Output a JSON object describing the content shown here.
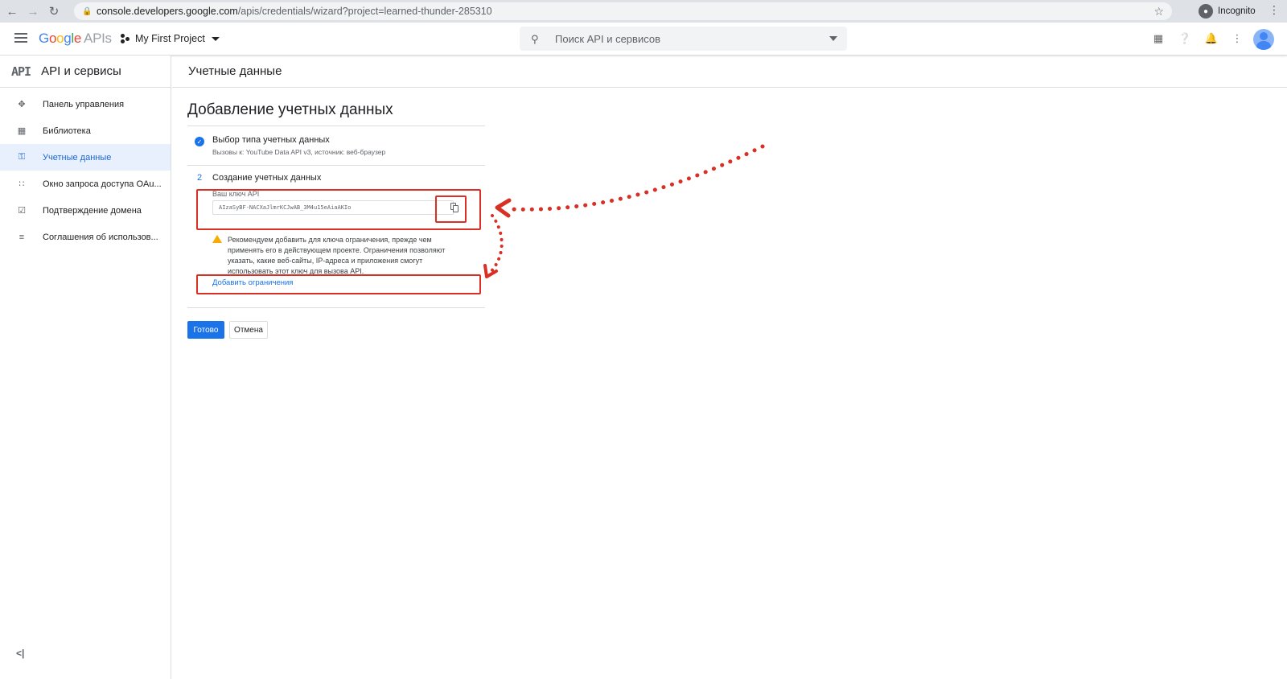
{
  "browser": {
    "url_host": "console.developers.google.com",
    "url_path": "/apis/credentials/wizard?project=learned-thunder-285310",
    "incognito_label": "Incognito"
  },
  "header": {
    "logo_google": [
      "G",
      "o",
      "o",
      "g",
      "l",
      "e"
    ],
    "logo_apis": "APIs",
    "project_name": "My First Project",
    "search_placeholder": "Поиск API и сервисов"
  },
  "sidebar": {
    "logo_text": "API",
    "title": "API и сервисы",
    "items": [
      {
        "label": "Панель управления",
        "icon": "dashboard-icon"
      },
      {
        "label": "Библиотека",
        "icon": "library-icon"
      },
      {
        "label": "Учетные данные",
        "icon": "key-icon",
        "active": true
      },
      {
        "label": "Окно запроса доступа OAu...",
        "icon": "consent-icon"
      },
      {
        "label": "Подтверждение домена",
        "icon": "domain-icon"
      },
      {
        "label": "Соглашения об использов...",
        "icon": "agreements-icon"
      }
    ],
    "collapse_icon": "collapse-icon"
  },
  "main": {
    "section_title": "Учетные данные",
    "page_title": "Добавление учетных данных",
    "step1": {
      "title": "Выбор типа учетных данных",
      "subtitle": "Вызовы к: YouTube Data API v3, источник: веб-браузер"
    },
    "step2": {
      "number": "2",
      "title": "Создание учетных данных",
      "key_label": "Ваш ключ API",
      "key_value": "AIzaSyBF-NACXaJlmrKCJwAB_3M4u15eAiaAKIo",
      "warning": "Рекомендуем добавить для ключа ограничения, прежде чем применять его в действующем проекте. Ограничения позволяют указать, какие веб-сайты, IP-адреса и приложения смогут использовать этот ключ для вызова API.",
      "restrict_link": "Добавить ограничения"
    },
    "done_label": "Готово",
    "cancel_label": "Отмена"
  },
  "colors": {
    "accent": "#1a73e8",
    "annotation": "#d93025",
    "warning": "#f9ab00"
  }
}
